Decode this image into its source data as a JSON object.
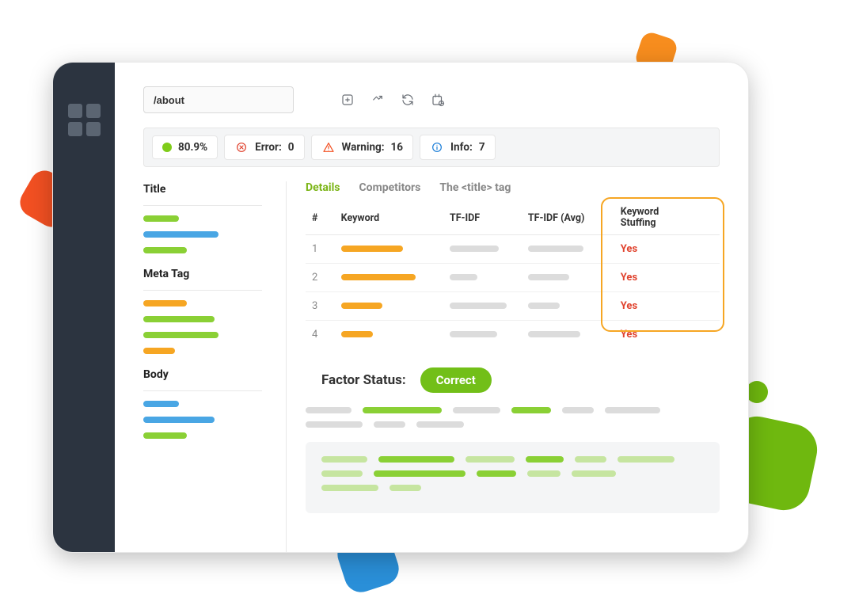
{
  "toolbar": {
    "url": "/about"
  },
  "status": {
    "score": "80.9%",
    "error_label": "Error:",
    "error_count": "0",
    "warning_label": "Warning:",
    "warning_count": "16",
    "info_label": "Info:",
    "info_count": "7"
  },
  "sections": {
    "title": "Title",
    "meta": "Meta Tag",
    "body": "Body"
  },
  "tabs": {
    "details": "Details",
    "competitors": "Competitors",
    "title_tag": "The <title> tag"
  },
  "table": {
    "headers": {
      "num": "#",
      "keyword": "Keyword",
      "tfidf": "TF-IDF",
      "tfidf_avg": "TF-IDF (Avg)",
      "stuffing": "Keyword Stuffing"
    },
    "rows": {
      "0": {
        "num": "1",
        "stuff": "Yes"
      },
      "1": {
        "num": "2",
        "stuff": "Yes"
      },
      "2": {
        "num": "3",
        "stuff": "Yes"
      },
      "3": {
        "num": "4",
        "stuff": "Yes"
      }
    }
  },
  "factor": {
    "label": "Factor Status:",
    "badge": "Correct"
  }
}
